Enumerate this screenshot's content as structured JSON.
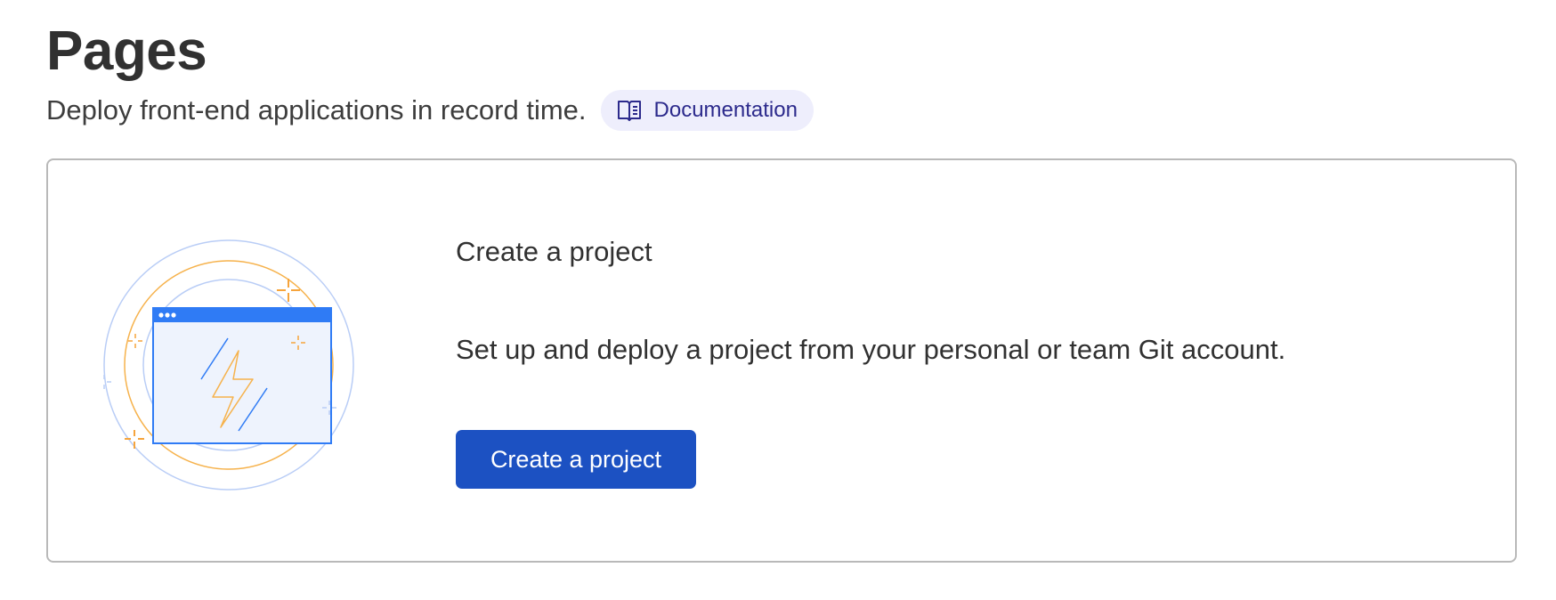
{
  "header": {
    "title": "Pages",
    "subtitle": "Deploy front-end applications in record time.",
    "documentation_label": "Documentation",
    "documentation_icon": "book-icon"
  },
  "card": {
    "title": "Create a project",
    "description": "Set up and deploy a project from your personal or team Git account.",
    "button_label": "Create a project",
    "illustration_icon": "browser-lightning-icon"
  },
  "colors": {
    "accent": "#1c51c2",
    "pill_bg": "#eeeefc",
    "pill_text": "#2c2a8c",
    "illustration_blue": "#2f7bf5",
    "illustration_orange": "#f6a43c"
  }
}
